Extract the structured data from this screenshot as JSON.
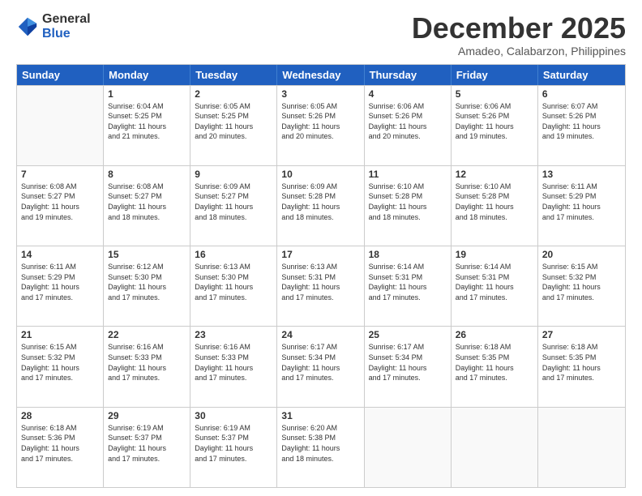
{
  "logo": {
    "general": "General",
    "blue": "Blue"
  },
  "title": "December 2025",
  "subtitle": "Amadeo, Calabarzon, Philippines",
  "days": [
    "Sunday",
    "Monday",
    "Tuesday",
    "Wednesday",
    "Thursday",
    "Friday",
    "Saturday"
  ],
  "weeks": [
    [
      {
        "day": "",
        "info": ""
      },
      {
        "day": "1",
        "info": "Sunrise: 6:04 AM\nSunset: 5:25 PM\nDaylight: 11 hours\nand 21 minutes."
      },
      {
        "day": "2",
        "info": "Sunrise: 6:05 AM\nSunset: 5:25 PM\nDaylight: 11 hours\nand 20 minutes."
      },
      {
        "day": "3",
        "info": "Sunrise: 6:05 AM\nSunset: 5:26 PM\nDaylight: 11 hours\nand 20 minutes."
      },
      {
        "day": "4",
        "info": "Sunrise: 6:06 AM\nSunset: 5:26 PM\nDaylight: 11 hours\nand 20 minutes."
      },
      {
        "day": "5",
        "info": "Sunrise: 6:06 AM\nSunset: 5:26 PM\nDaylight: 11 hours\nand 19 minutes."
      },
      {
        "day": "6",
        "info": "Sunrise: 6:07 AM\nSunset: 5:26 PM\nDaylight: 11 hours\nand 19 minutes."
      }
    ],
    [
      {
        "day": "7",
        "info": "Sunrise: 6:08 AM\nSunset: 5:27 PM\nDaylight: 11 hours\nand 19 minutes."
      },
      {
        "day": "8",
        "info": "Sunrise: 6:08 AM\nSunset: 5:27 PM\nDaylight: 11 hours\nand 18 minutes."
      },
      {
        "day": "9",
        "info": "Sunrise: 6:09 AM\nSunset: 5:27 PM\nDaylight: 11 hours\nand 18 minutes."
      },
      {
        "day": "10",
        "info": "Sunrise: 6:09 AM\nSunset: 5:28 PM\nDaylight: 11 hours\nand 18 minutes."
      },
      {
        "day": "11",
        "info": "Sunrise: 6:10 AM\nSunset: 5:28 PM\nDaylight: 11 hours\nand 18 minutes."
      },
      {
        "day": "12",
        "info": "Sunrise: 6:10 AM\nSunset: 5:28 PM\nDaylight: 11 hours\nand 18 minutes."
      },
      {
        "day": "13",
        "info": "Sunrise: 6:11 AM\nSunset: 5:29 PM\nDaylight: 11 hours\nand 17 minutes."
      }
    ],
    [
      {
        "day": "14",
        "info": "Sunrise: 6:11 AM\nSunset: 5:29 PM\nDaylight: 11 hours\nand 17 minutes."
      },
      {
        "day": "15",
        "info": "Sunrise: 6:12 AM\nSunset: 5:30 PM\nDaylight: 11 hours\nand 17 minutes."
      },
      {
        "day": "16",
        "info": "Sunrise: 6:13 AM\nSunset: 5:30 PM\nDaylight: 11 hours\nand 17 minutes."
      },
      {
        "day": "17",
        "info": "Sunrise: 6:13 AM\nSunset: 5:31 PM\nDaylight: 11 hours\nand 17 minutes."
      },
      {
        "day": "18",
        "info": "Sunrise: 6:14 AM\nSunset: 5:31 PM\nDaylight: 11 hours\nand 17 minutes."
      },
      {
        "day": "19",
        "info": "Sunrise: 6:14 AM\nSunset: 5:31 PM\nDaylight: 11 hours\nand 17 minutes."
      },
      {
        "day": "20",
        "info": "Sunrise: 6:15 AM\nSunset: 5:32 PM\nDaylight: 11 hours\nand 17 minutes."
      }
    ],
    [
      {
        "day": "21",
        "info": "Sunrise: 6:15 AM\nSunset: 5:32 PM\nDaylight: 11 hours\nand 17 minutes."
      },
      {
        "day": "22",
        "info": "Sunrise: 6:16 AM\nSunset: 5:33 PM\nDaylight: 11 hours\nand 17 minutes."
      },
      {
        "day": "23",
        "info": "Sunrise: 6:16 AM\nSunset: 5:33 PM\nDaylight: 11 hours\nand 17 minutes."
      },
      {
        "day": "24",
        "info": "Sunrise: 6:17 AM\nSunset: 5:34 PM\nDaylight: 11 hours\nand 17 minutes."
      },
      {
        "day": "25",
        "info": "Sunrise: 6:17 AM\nSunset: 5:34 PM\nDaylight: 11 hours\nand 17 minutes."
      },
      {
        "day": "26",
        "info": "Sunrise: 6:18 AM\nSunset: 5:35 PM\nDaylight: 11 hours\nand 17 minutes."
      },
      {
        "day": "27",
        "info": "Sunrise: 6:18 AM\nSunset: 5:35 PM\nDaylight: 11 hours\nand 17 minutes."
      }
    ],
    [
      {
        "day": "28",
        "info": "Sunrise: 6:18 AM\nSunset: 5:36 PM\nDaylight: 11 hours\nand 17 minutes."
      },
      {
        "day": "29",
        "info": "Sunrise: 6:19 AM\nSunset: 5:37 PM\nDaylight: 11 hours\nand 17 minutes."
      },
      {
        "day": "30",
        "info": "Sunrise: 6:19 AM\nSunset: 5:37 PM\nDaylight: 11 hours\nand 17 minutes."
      },
      {
        "day": "31",
        "info": "Sunrise: 6:20 AM\nSunset: 5:38 PM\nDaylight: 11 hours\nand 18 minutes."
      },
      {
        "day": "",
        "info": ""
      },
      {
        "day": "",
        "info": ""
      },
      {
        "day": "",
        "info": ""
      }
    ]
  ]
}
